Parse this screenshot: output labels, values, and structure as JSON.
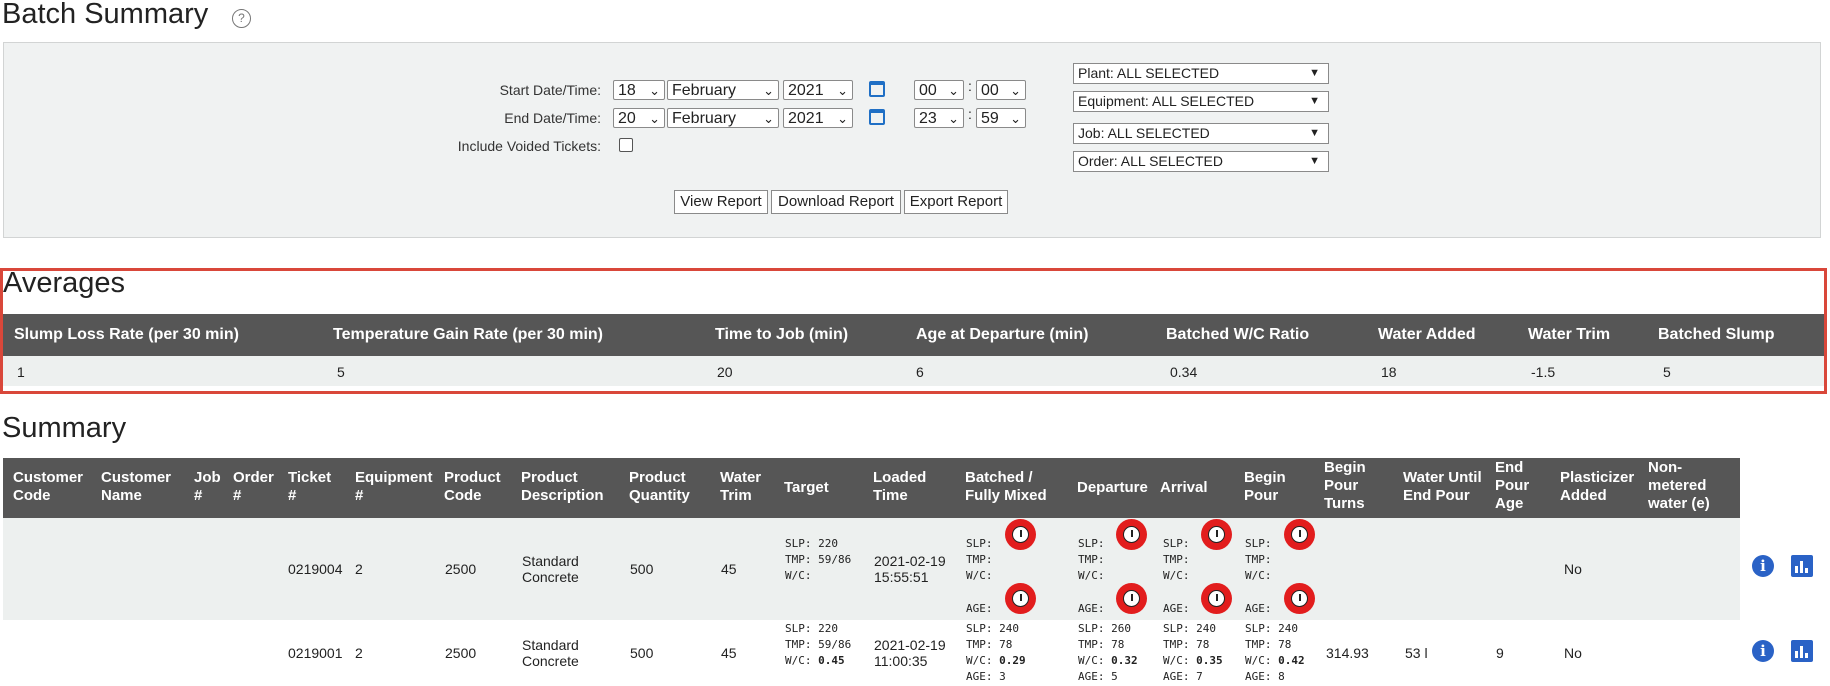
{
  "page": {
    "title": "Batch Summary",
    "help_icon": "question-circle-icon"
  },
  "filters": {
    "start_label": "Start Date/Time:",
    "end_label": "End Date/Time:",
    "voided_label": "Include Voided Tickets:",
    "include_voided": false,
    "start": {
      "day": "18",
      "month": "February",
      "year": "2021",
      "hour": "00",
      "minute": "00"
    },
    "end": {
      "day": "20",
      "month": "February",
      "year": "2021",
      "hour": "23",
      "minute": "59"
    },
    "plant": "Plant: ALL SELECTED",
    "equipment": "Equipment: ALL SELECTED",
    "job": "Job: ALL SELECTED",
    "order": "Order: ALL SELECTED",
    "buttons": {
      "view": "View Report",
      "download": "Download Report",
      "export": "Export Report"
    }
  },
  "averages": {
    "title": "Averages",
    "headers": [
      "Slump Loss Rate (per 30 min)",
      "Temperature Gain Rate (per 30 min)",
      "Time to Job (min)",
      "Age at Departure (min)",
      "Batched W/C Ratio",
      "Water Added",
      "Water Trim",
      "Batched Slump"
    ],
    "values": [
      "1",
      "5",
      "20",
      "6",
      "0.34",
      "18",
      "-1.5",
      "5"
    ]
  },
  "summary": {
    "title": "Summary",
    "headers": [
      "Customer Code",
      "Customer Name",
      "Job #",
      "Order #",
      "Ticket #",
      "Equipment #",
      "Product Code",
      "Product Description",
      "Product Quantity",
      "Water Trim",
      "Target",
      "Loaded Time",
      "Batched / Fully Mixed",
      "Departure",
      "Arrival",
      "Begin Pour",
      "Begin Pour Turns",
      "Water Until End Pour",
      "End Pour Age",
      "Plasticizer Added",
      "Non-metered water (e)"
    ],
    "rows": [
      {
        "ticket": "0219004",
        "equipment": "2",
        "product_code": "2500",
        "desc1": "Standard",
        "desc2": "Concrete",
        "quantity": "500",
        "water_trim": "45",
        "target": {
          "slp": "SLP: 220",
          "tmp": "TMP: 59/86",
          "wc": "W/C:",
          "wc_val": ""
        },
        "loaded_date": "2021-02-19",
        "loaded_time": "15:55:51",
        "batched": {
          "slp": "SLP:",
          "tmp": "TMP:",
          "wc": "W/C:",
          "age": "AGE:"
        },
        "departure": {
          "slp": "SLP:",
          "tmp": "TMP:",
          "wc": "W/C:",
          "age": "AGE:"
        },
        "arrival": {
          "slp": "SLP:",
          "tmp": "TMP:",
          "wc": "W/C:",
          "age": "AGE:"
        },
        "begin_pour": {
          "slp": "SLP:",
          "tmp": "TMP:",
          "wc": "W/C:",
          "age": "AGE:"
        },
        "turns": "",
        "water_until": "",
        "end_age": "",
        "plasticizer": "No"
      },
      {
        "ticket": "0219001",
        "equipment": "2",
        "product_code": "2500",
        "desc1": "Standard",
        "desc2": "Concrete",
        "quantity": "500",
        "water_trim": "45",
        "target": {
          "slp": "SLP: 220",
          "tmp": "TMP: 59/86",
          "wc": "W/C:",
          "wc_val": "0.45"
        },
        "loaded_date": "2021-02-19",
        "loaded_time": "11:00:35",
        "batched": {
          "slp": "SLP: 240",
          "tmp": "TMP: 78",
          "wc": "W/C:",
          "wc_val": "0.29",
          "age": "AGE: 3"
        },
        "departure": {
          "slp": "SLP: 260",
          "tmp": "TMP: 78",
          "wc": "W/C:",
          "wc_val": "0.32",
          "age": "AGE: 5"
        },
        "arrival": {
          "slp": "SLP: 240",
          "tmp": "TMP: 78",
          "wc": "W/C:",
          "wc_val": "0.35",
          "age": "AGE: 7"
        },
        "begin_pour": {
          "slp": "SLP: 240",
          "tmp": "TMP: 78",
          "wc": "W/C:",
          "wc_val": "0.42",
          "age": "AGE: 8"
        },
        "turns": "314.93",
        "water_until": "53 l",
        "end_age": "9",
        "plasticizer": "No"
      }
    ]
  },
  "colors": {
    "header_bg": "#565656",
    "highlight": "#d9473a",
    "accent": "#2a62c6",
    "alarm": "#e21d1d"
  }
}
